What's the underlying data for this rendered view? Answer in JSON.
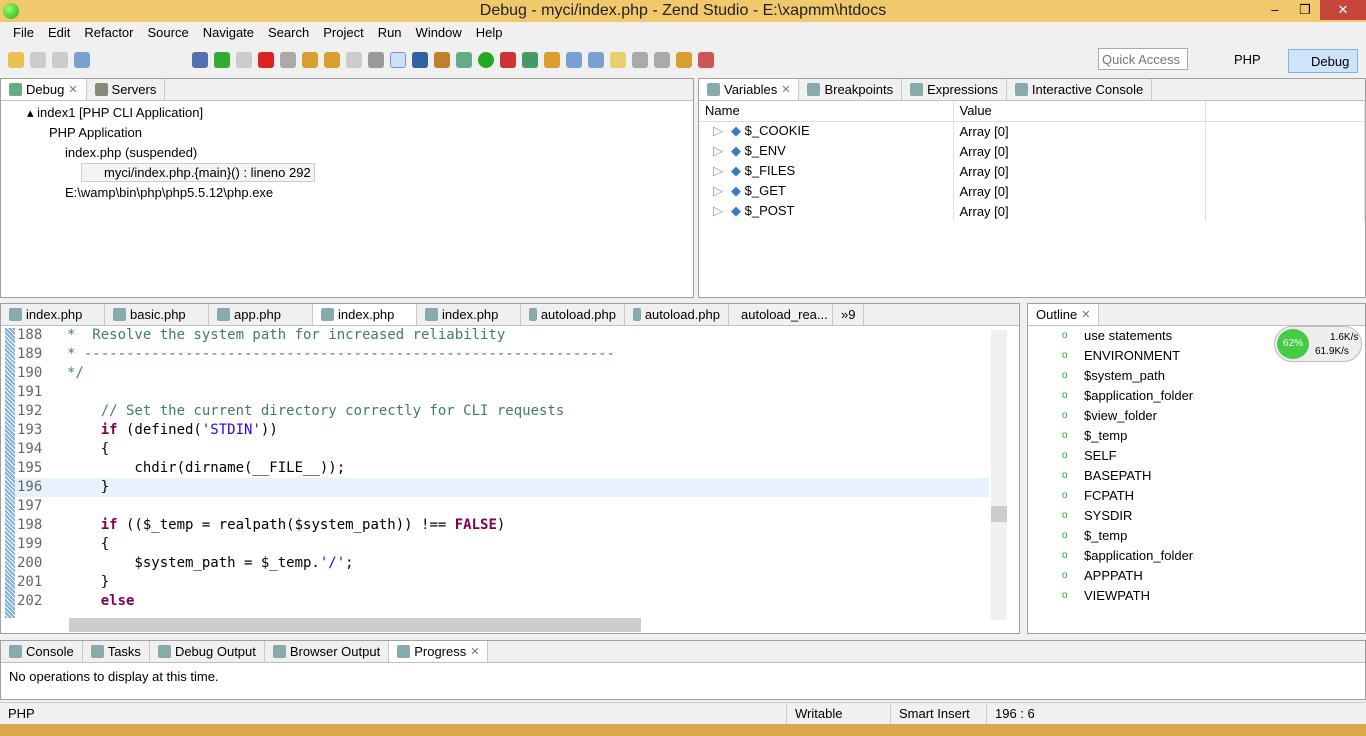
{
  "window": {
    "title": "Debug - myci/index.php - Zend Studio - E:\\xapmm\\htdocs"
  },
  "menu": [
    "File",
    "Edit",
    "Refactor",
    "Source",
    "Navigate",
    "Search",
    "Project",
    "Run",
    "Window",
    "Help"
  ],
  "toolbar": {
    "quick_access_placeholder": "Quick Access",
    "perspectives": [
      "PHP",
      "Debug"
    ]
  },
  "debug_panel": {
    "tabs": [
      "Debug",
      "Servers"
    ],
    "tree": [
      "index1 [PHP CLI Application]",
      "PHP Application",
      "index.php (suspended)",
      "myci/index.php.{main}() : lineno 292",
      "E:\\wamp\\bin\\php\\php5.5.12\\php.exe"
    ]
  },
  "variables_panel": {
    "tabs": [
      "Variables",
      "Breakpoints",
      "Expressions",
      "Interactive Console"
    ],
    "columns": [
      "Name",
      "Value"
    ],
    "rows": [
      {
        "name": "$_COOKIE",
        "value": "Array [0]"
      },
      {
        "name": "$_ENV",
        "value": "Array [0]"
      },
      {
        "name": "$_FILES",
        "value": "Array [0]"
      },
      {
        "name": "$_GET",
        "value": "Array [0]"
      },
      {
        "name": "$_POST",
        "value": "Array [0]"
      }
    ]
  },
  "editor": {
    "tabs": [
      "index.php",
      "basic.php",
      "app.php",
      "index.php",
      "index.php",
      "autoload.php",
      "autoload.php",
      "autoload_rea..."
    ],
    "overflow": "»9",
    "active_tab": 3,
    "lines": [
      {
        "n": "188",
        "t": "*  Resolve the system path for increased reliability",
        "c": "cm"
      },
      {
        "n": "189",
        "t": "* ---------------------------------------------------------------",
        "c": "cm"
      },
      {
        "n": "190",
        "t": "*/",
        "c": "cm"
      },
      {
        "n": "191",
        "t": ""
      },
      {
        "n": "192",
        "t": "    // Set the current directory correctly for CLI requests",
        "c": "cm"
      },
      {
        "n": "193",
        "t": "    if (defined('STDIN'))"
      },
      {
        "n": "194",
        "t": "    {"
      },
      {
        "n": "195",
        "t": "        chdir(dirname(__FILE__));"
      },
      {
        "n": "196",
        "t": "    }",
        "hl": true
      },
      {
        "n": "197",
        "t": ""
      },
      {
        "n": "198",
        "t": "    if (($_temp = realpath($system_path)) !== FALSE)"
      },
      {
        "n": "199",
        "t": "    {"
      },
      {
        "n": "200",
        "t": "        $system_path = $_temp.'/';"
      },
      {
        "n": "201",
        "t": "    }"
      },
      {
        "n": "202",
        "t": "    else"
      }
    ]
  },
  "outline": {
    "tab": "Outline",
    "items": [
      "use statements",
      "ENVIRONMENT",
      "$system_path",
      "$application_folder",
      "$view_folder",
      "$_temp",
      "SELF",
      "BASEPATH",
      "FCPATH",
      "SYSDIR",
      "$_temp",
      "$application_folder",
      "APPPATH",
      "VIEWPATH"
    ]
  },
  "net_widget": {
    "percent": "62%",
    "up": "1.6K/s",
    "down": "61.9K/s"
  },
  "bottom_panel": {
    "tabs": [
      "Console",
      "Tasks",
      "Debug Output",
      "Browser Output",
      "Progress"
    ],
    "message": "No operations to display at this time."
  },
  "status": {
    "lang": "PHP",
    "mode": "Writable",
    "insert": "Smart Insert",
    "position": "196 : 6"
  }
}
